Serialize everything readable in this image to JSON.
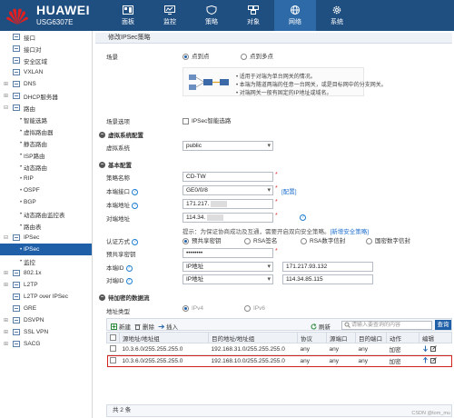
{
  "header": {
    "brand": "HUAWEI",
    "model": "USG6307E",
    "nav": [
      {
        "label": "面板",
        "icon": "dashboard-icon"
      },
      {
        "label": "监控",
        "icon": "monitor-icon"
      },
      {
        "label": "策略",
        "icon": "policy-icon"
      },
      {
        "label": "对象",
        "icon": "object-icon"
      },
      {
        "label": "网络",
        "icon": "network-icon",
        "active": true
      },
      {
        "label": "系统",
        "icon": "system-icon"
      }
    ]
  },
  "sidebar": {
    "items": [
      {
        "label": "接口",
        "level": 1
      },
      {
        "label": "接口对",
        "level": 1
      },
      {
        "label": "安全区域",
        "level": 1
      },
      {
        "label": "VXLAN",
        "level": 1
      },
      {
        "label": "DNS",
        "level": 1,
        "expand": "+"
      },
      {
        "label": "DHCP服务器",
        "level": 1,
        "expand": "+"
      },
      {
        "label": "路由",
        "level": 1,
        "expand": "-"
      },
      {
        "label": "智能选路",
        "level": 2
      },
      {
        "label": "虚拟路由器",
        "level": 2
      },
      {
        "label": "静态路由",
        "level": 2
      },
      {
        "label": "ISP路由",
        "level": 2
      },
      {
        "label": "动态路由",
        "level": 2
      },
      {
        "label": "RIP",
        "level": 2
      },
      {
        "label": "OSPF",
        "level": 2
      },
      {
        "label": "BGP",
        "level": 2
      },
      {
        "label": "动态路由监控表",
        "level": 2
      },
      {
        "label": "路由表",
        "level": 2
      },
      {
        "label": "IPSec",
        "level": 1,
        "expand": "-"
      },
      {
        "label": "IPSec",
        "level": 2,
        "active": true
      },
      {
        "label": "监控",
        "level": 2
      },
      {
        "label": "802.1x",
        "level": 1,
        "expand": "+"
      },
      {
        "label": "L2TP",
        "level": 1,
        "expand": "+"
      },
      {
        "label": "L2TP over IPSec",
        "level": 1
      },
      {
        "label": "GRE",
        "level": 1
      },
      {
        "label": "DSVPN",
        "level": 1,
        "expand": "+"
      },
      {
        "label": "SSL VPN",
        "level": 1,
        "expand": "+"
      },
      {
        "label": "SACG",
        "level": 1,
        "expand": "+"
      }
    ]
  },
  "page": {
    "title": "修改IPSec策略",
    "scene_label": "场景",
    "scene_p2p": "点到点",
    "scene_p2mp": "点到多点",
    "diagram_lines": [
      "适用于对端为单台网关的情况。",
      "本端为隧道两端的任意一台网关，或是目标网中的分支网关。",
      "对端网关一般有固定的IP地址或域名。"
    ],
    "scene_option_label": "场景选项",
    "scene_option_check": "IPSec智能选路",
    "vsys_section": "虚拟系统配置",
    "vsys_label": "虚拟系统",
    "vsys_value": "public",
    "basic_section": "基本配置",
    "policy_name_label": "策略名称",
    "policy_name_value": "CD-TW",
    "local_if_label": "本端接口",
    "local_if_value": "GE0/0/8",
    "local_if_link": "[配置]",
    "local_addr_label": "本端地址",
    "local_addr_value": "171.217.",
    "peer_addr_label": "对端地址",
    "peer_addr_value": "114.34.",
    "auth_hint": "提示：为保证协商成功及互通，需要开启双向安全策略。",
    "auth_hint_link": "[新增安全策略]",
    "auth_label": "认证方式",
    "auth_options": [
      "预共享密钥",
      "RSA签名",
      "RSA数字信封",
      "国密数字信封"
    ],
    "psk_label": "预共享密钥",
    "psk_value": "••••••••",
    "local_id_label": "本端ID",
    "local_id_type": "IP地址",
    "local_id_value": "171.217.93.132",
    "peer_id_label": "对端ID",
    "peer_id_type": "IP地址",
    "peer_id_value": "114.34.85.115",
    "flow_section": "待加密的数据流",
    "addr_type_label": "地址类型",
    "addr_ipv4": "IPv4",
    "addr_ipv6": "IPv6"
  },
  "table": {
    "new": "新建",
    "delete": "删除",
    "insert": "插入",
    "refresh": "刷新",
    "search_placeholder": "请输入要查询的内容",
    "query": "查询",
    "headers": [
      "源地址/地址组",
      "目的地址/地址组",
      "协议",
      "源端口",
      "目的端口",
      "动作",
      "编辑"
    ],
    "rows": [
      {
        "src": "10.3.6.0/255.255.255.0",
        "dst": "192.168.31.0/255.255.255.0",
        "proto": "any",
        "sport": "any",
        "dport": "any",
        "action": "加密"
      },
      {
        "src": "10.3.6.0/255.255.255.0",
        "dst": "192.168.10.0/255.255.255.0",
        "proto": "any",
        "sport": "any",
        "dport": "any",
        "action": "加密",
        "highlight": true
      }
    ],
    "footer": "共 2 条"
  },
  "watermark": "CSDN @tom_mu",
  "colors": {
    "topbar": "#1f4e80",
    "accent": "#1f5fa8",
    "highlight_border": "#d0231e",
    "encrypt_green": "#1e9e3a"
  }
}
